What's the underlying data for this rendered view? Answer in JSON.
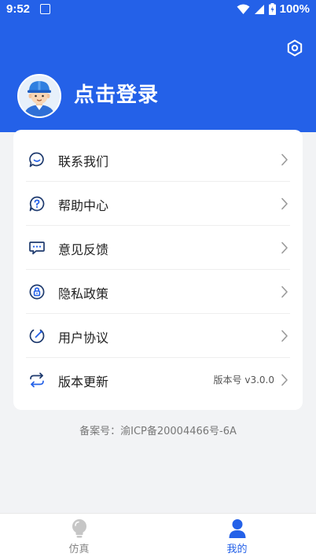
{
  "status_bar": {
    "time": "9:52",
    "battery": "100%"
  },
  "header": {
    "login_text": "点击登录",
    "settings_icon": "settings-hexagon-icon",
    "avatar": "worker-avatar",
    "background_color": "#2461e8"
  },
  "menu": {
    "items": [
      {
        "label": "联系我们",
        "icon": "chat-bubble-icon",
        "value": ""
      },
      {
        "label": "帮助中心",
        "icon": "help-icon",
        "value": ""
      },
      {
        "label": "意见反馈",
        "icon": "feedback-icon",
        "value": ""
      },
      {
        "label": "隐私政策",
        "icon": "privacy-icon",
        "value": ""
      },
      {
        "label": "用户协议",
        "icon": "agreement-icon",
        "value": ""
      },
      {
        "label": "版本更新",
        "icon": "update-icon",
        "value": "版本号 v3.0.0"
      }
    ]
  },
  "footer": {
    "icp": "备案号：渝ICP备20004466号-6A"
  },
  "tabbar": {
    "tabs": [
      {
        "label": "仿真",
        "icon": "bulb-icon",
        "active": false
      },
      {
        "label": "我的",
        "icon": "user-icon",
        "active": true
      }
    ],
    "active_color": "#2461e8",
    "inactive_color": "#888888"
  }
}
